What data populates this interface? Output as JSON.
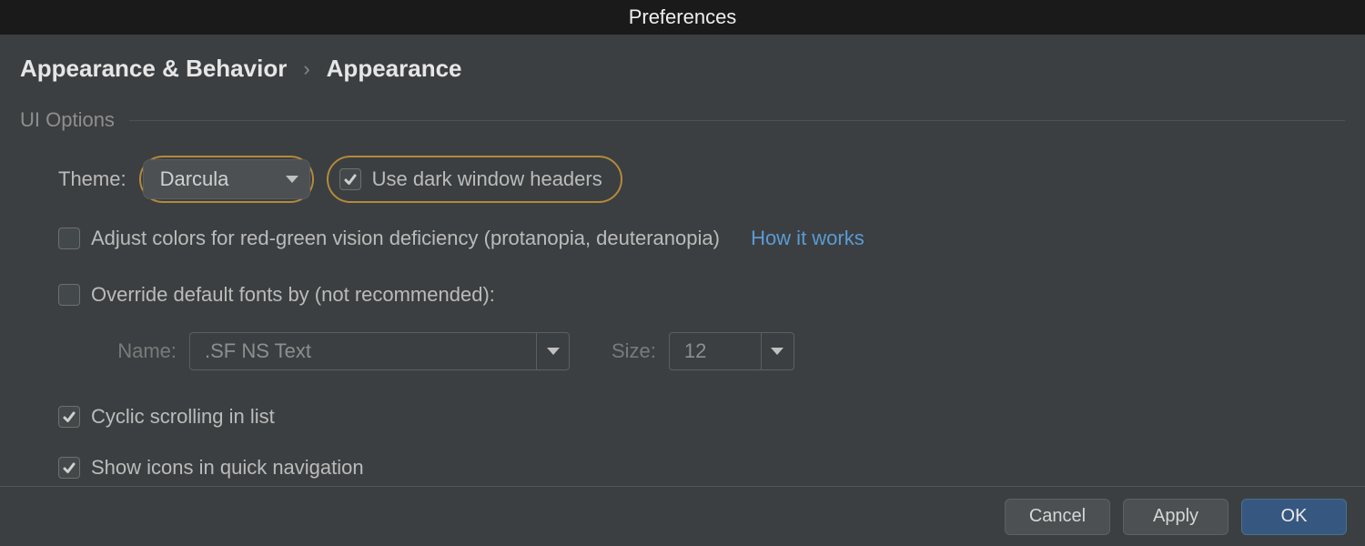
{
  "window": {
    "title": "Preferences"
  },
  "breadcrumb": {
    "root": "Appearance & Behavior",
    "leaf": "Appearance"
  },
  "section": {
    "title": "UI Options",
    "theme_label": "Theme:",
    "theme_value": "Darcula",
    "use_dark_headers": {
      "label": "Use dark window headers",
      "checked": true
    },
    "adjust_colors": {
      "label": "Adjust colors for red-green vision deficiency (protanopia, deuteranopia)",
      "checked": false,
      "link": "How it works"
    },
    "override_fonts": {
      "label": "Override default fonts by (not recommended):",
      "checked": false
    },
    "font_name_label": "Name:",
    "font_name_value": ".SF NS Text",
    "font_size_label": "Size:",
    "font_size_value": "12",
    "cyclic_scrolling": {
      "label": "Cyclic scrolling in list",
      "checked": true
    },
    "show_icons_quicknav": {
      "label": "Show icons in quick navigation",
      "checked": true
    }
  },
  "footer": {
    "cancel": "Cancel",
    "apply": "Apply",
    "ok": "OK"
  }
}
